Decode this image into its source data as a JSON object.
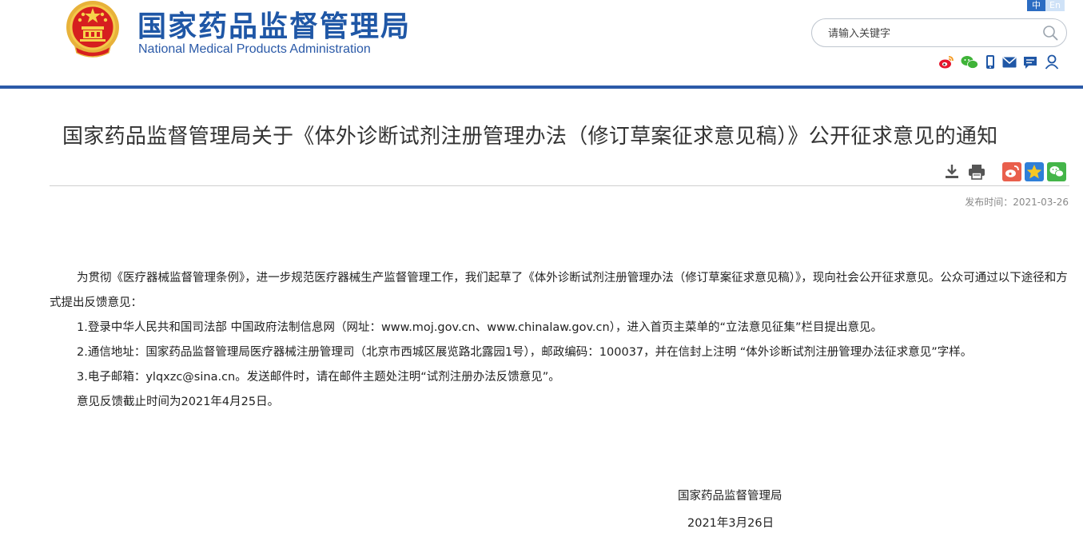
{
  "header": {
    "cn_name": "国家药品监督管理局",
    "en_name": "National Medical Products Administration",
    "lang_zh": "中",
    "lang_en": "En",
    "search_placeholder": "请输入关键字",
    "brand_color": "#2b5aa8",
    "social_icons": [
      "weibo-icon",
      "wechat-icon",
      "mobile-icon",
      "mail-icon",
      "message-icon",
      "user-icon"
    ]
  },
  "article": {
    "title": "国家药品监督管理局关于《体外诊断试剂注册管理办法（修订草案征求意见稿）》公开征求意见的通知",
    "tools": [
      "download-icon",
      "print-icon",
      "weibo-share-icon",
      "favorite-icon",
      "wechat-share-icon"
    ],
    "publish_label": "发布时间：",
    "publish_date": "2021-03-26",
    "paragraphs": [
      "为贯彻《医疗器械监督管理条例》，进一步规范医疗器械生产监督管理工作，我们起草了《体外诊断试剂注册管理办法（修订草案征求意见稿）》，现向社会公开征求意见。公众可通过以下途径和方式提出反馈意见：",
      "1.登录中华人民共和国司法部 中国政府法制信息网（网址：www.moj.gov.cn、www.chinalaw.gov.cn），进入首页主菜单的“立法意见征集”栏目提出意见。",
      "2.通信地址：国家药品监督管理局医疗器械注册管理司（北京市西城区展览路北露园1号），邮政编码：100037，并在信封上注明 “体外诊断试剂注册管理办法征求意见”字样。",
      "3.电子邮箱：ylqxzc@sina.cn。发送邮件时，请在邮件主题处注明“试剂注册办法反馈意见”。",
      "意见反馈截止时间为2021年4月25日。"
    ],
    "signature_org": "国家药品监督管理局",
    "signature_date": "2021年3月26日"
  }
}
